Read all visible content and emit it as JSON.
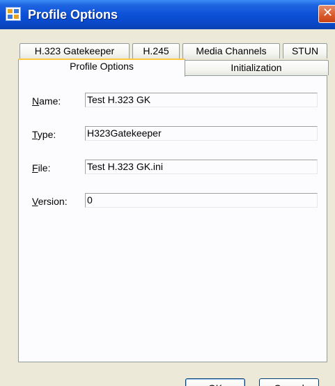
{
  "window": {
    "title": "Profile Options",
    "close_glyph": "✕"
  },
  "tabs_row1": [
    {
      "label": "H.323 Gatekeeper"
    },
    {
      "label": "H.245"
    },
    {
      "label": "Media Channels"
    },
    {
      "label": "STUN"
    }
  ],
  "tabs_row2": [
    {
      "label": "Profile Options",
      "active": true
    },
    {
      "label": "Initialization",
      "active": false
    }
  ],
  "form": {
    "name": {
      "label_accel": "N",
      "label_rest": "ame:",
      "value": "Test H.323 GK"
    },
    "type": {
      "label_accel": "T",
      "label_rest": "ype:",
      "value": "H323Gatekeeper"
    },
    "file": {
      "label_accel": "F",
      "label_rest": "ile:",
      "value": "Test H.323 GK.ini"
    },
    "version": {
      "label_accel": "V",
      "label_rest": "ersion:",
      "value": "0"
    }
  },
  "buttons": {
    "ok": {
      "accel": "O",
      "rest": "K"
    },
    "cancel": {
      "accel": "C",
      "rest": "ancel"
    }
  }
}
